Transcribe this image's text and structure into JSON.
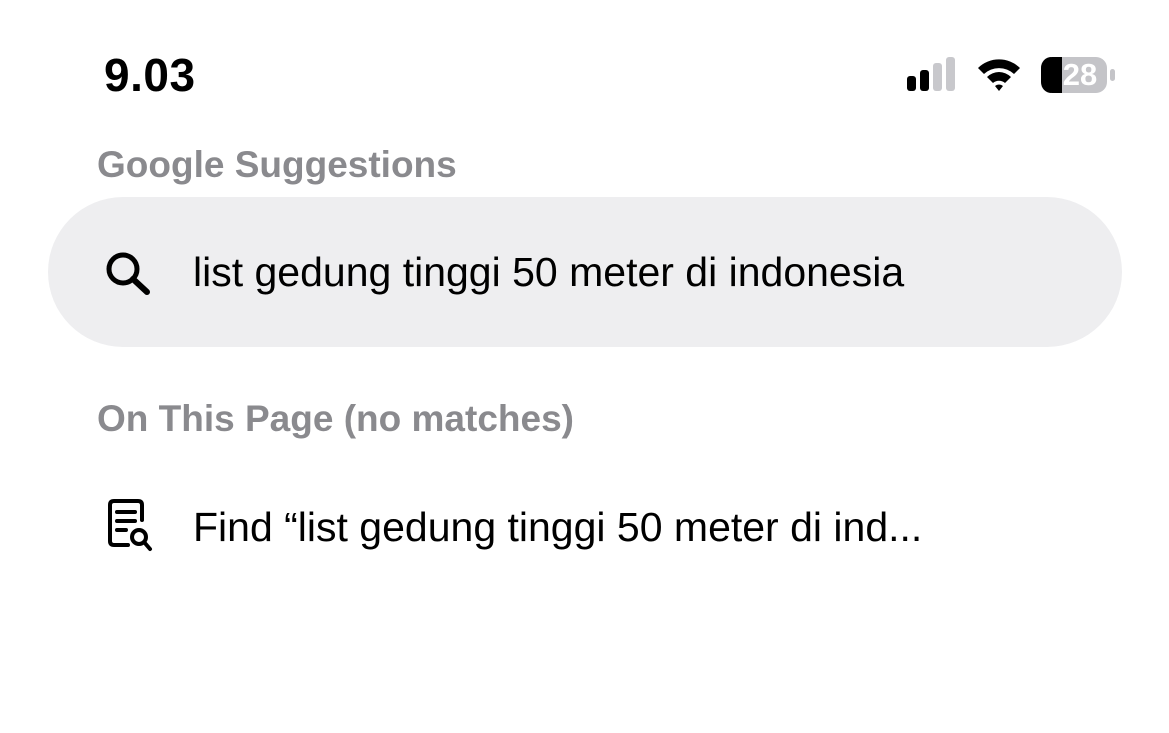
{
  "status_bar": {
    "time": "9.03",
    "battery_level": "28",
    "signal_icon": "cellular-signal-icon",
    "wifi_icon": "wifi-icon"
  },
  "sections": {
    "google_suggestions": {
      "header": "Google Suggestions",
      "items": [
        {
          "icon": "search-icon",
          "text": "list gedung tinggi 50 meter di indonesia"
        }
      ]
    },
    "on_this_page": {
      "header": "On This Page (no matches)",
      "items": [
        {
          "icon": "find-on-page-icon",
          "text": "Find “list gedung tinggi 50 meter di ind..."
        }
      ]
    }
  },
  "colors": {
    "header_gray": "#8a8a8e",
    "pill_background": "#eeeef0"
  }
}
